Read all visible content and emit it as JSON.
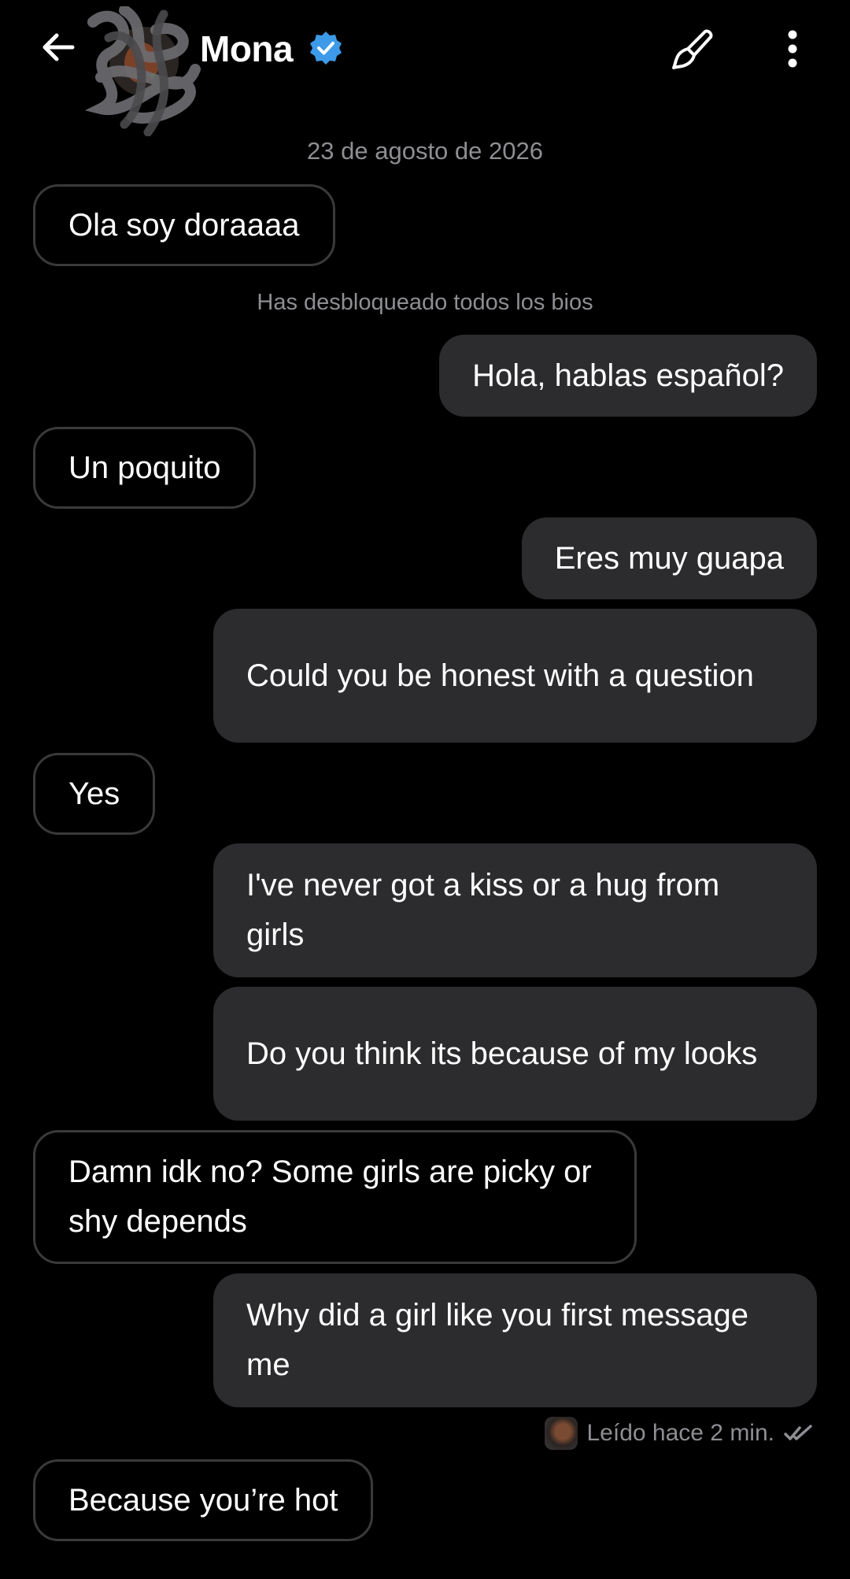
{
  "header": {
    "contact_name": "Mona",
    "icons": {
      "back": "arrow-left-icon",
      "verified": "verified-badge-icon",
      "brush": "paint-brush-icon",
      "more": "more-vertical-icon"
    },
    "colors": {
      "verified": "#3d9ae8"
    }
  },
  "chat": {
    "date_separator": "23 de agosto de 2026",
    "system_note": "Has desbloqueado todos los bios",
    "messages": [
      {
        "direction": "in",
        "text": "Ola soy doraaaa"
      },
      {
        "direction": "out",
        "text": "Hola, hablas español?"
      },
      {
        "direction": "in",
        "text": "Un poquito"
      },
      {
        "direction": "out",
        "text": "Eres muy guapa"
      },
      {
        "direction": "out",
        "text": "Could you be honest with a question"
      },
      {
        "direction": "in",
        "text": "Yes"
      },
      {
        "direction": "out",
        "text": "I've never got a kiss or a hug from girls"
      },
      {
        "direction": "out",
        "text": "Do you think its because of my looks"
      },
      {
        "direction": "in",
        "text": "Damn idk no? Some girls are picky or shy depends"
      },
      {
        "direction": "out",
        "text": "Why did a girl like you first message me"
      },
      {
        "direction": "in",
        "text": "Because you’re hot"
      }
    ],
    "read_receipt": "Leído hace 2 min.",
    "read_icon": "double-check-icon"
  },
  "colors": {
    "background": "#000000",
    "outgoing_bubble": "#2c2c2e",
    "incoming_border": "#3a3a3c",
    "secondary_text": "#8e8e93"
  }
}
